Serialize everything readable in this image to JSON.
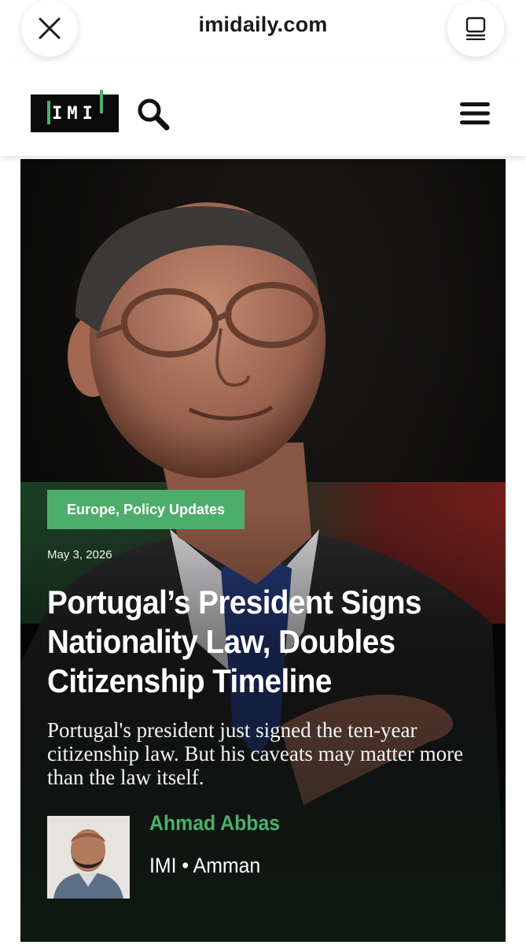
{
  "browser": {
    "url": "imidaily.com",
    "close_icon": "close-icon",
    "reader_icon": "reader-mode-icon"
  },
  "header": {
    "logo_text": "IMI",
    "search_icon": "search-icon",
    "menu_icon": "hamburger-menu-icon",
    "accent_color": "#4dae6b"
  },
  "article": {
    "category": "Europe, Policy Updates",
    "date": "May 3, 2026",
    "headline": "Portugal’s President Signs Nationality Law, Doubles Citizenship Timeline",
    "summary": "Portugal's president just signed the ten-year citizenship law. But his caveats may matter more than the law itself.",
    "author": {
      "name": "Ahmad Abbas",
      "meta": "IMI • Amman"
    }
  }
}
